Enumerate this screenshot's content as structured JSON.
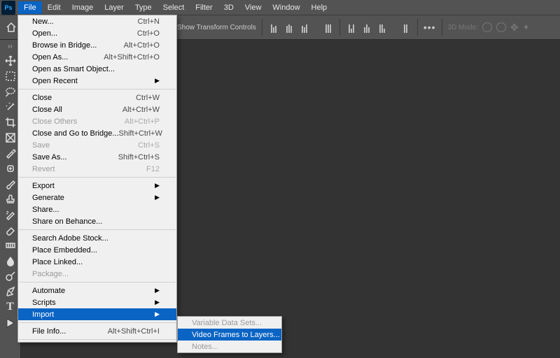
{
  "app": {
    "short": "Ps"
  },
  "menubar": [
    "File",
    "Edit",
    "Image",
    "Layer",
    "Type",
    "Select",
    "Filter",
    "3D",
    "View",
    "Window",
    "Help"
  ],
  "options": {
    "show_transform": "Show Transform Controls",
    "mode_label": "3D Mode:"
  },
  "file_menu": [
    {
      "type": "item",
      "label": "New...",
      "shortcut": "Ctrl+N"
    },
    {
      "type": "item",
      "label": "Open...",
      "shortcut": "Ctrl+O"
    },
    {
      "type": "item",
      "label": "Browse in Bridge...",
      "shortcut": "Alt+Ctrl+O"
    },
    {
      "type": "item",
      "label": "Open As...",
      "shortcut": "Alt+Shift+Ctrl+O"
    },
    {
      "type": "item",
      "label": "Open as Smart Object..."
    },
    {
      "type": "item",
      "label": "Open Recent",
      "sub": true
    },
    {
      "type": "sep"
    },
    {
      "type": "item",
      "label": "Close",
      "shortcut": "Ctrl+W"
    },
    {
      "type": "item",
      "label": "Close All",
      "shortcut": "Alt+Ctrl+W"
    },
    {
      "type": "item",
      "label": "Close Others",
      "shortcut": "Alt+Ctrl+P",
      "disabled": true
    },
    {
      "type": "item",
      "label": "Close and Go to Bridge...",
      "shortcut": "Shift+Ctrl+W"
    },
    {
      "type": "item",
      "label": "Save",
      "shortcut": "Ctrl+S",
      "disabled": true
    },
    {
      "type": "item",
      "label": "Save As...",
      "shortcut": "Shift+Ctrl+S"
    },
    {
      "type": "item",
      "label": "Revert",
      "shortcut": "F12",
      "disabled": true
    },
    {
      "type": "sep"
    },
    {
      "type": "item",
      "label": "Export",
      "sub": true
    },
    {
      "type": "item",
      "label": "Generate",
      "sub": true
    },
    {
      "type": "item",
      "label": "Share..."
    },
    {
      "type": "item",
      "label": "Share on Behance..."
    },
    {
      "type": "sep"
    },
    {
      "type": "item",
      "label": "Search Adobe Stock..."
    },
    {
      "type": "item",
      "label": "Place Embedded..."
    },
    {
      "type": "item",
      "label": "Place Linked..."
    },
    {
      "type": "item",
      "label": "Package...",
      "disabled": true
    },
    {
      "type": "sep"
    },
    {
      "type": "item",
      "label": "Automate",
      "sub": true
    },
    {
      "type": "item",
      "label": "Scripts",
      "sub": true
    },
    {
      "type": "item",
      "label": "Import",
      "sub": true,
      "highlight": true
    },
    {
      "type": "sep"
    },
    {
      "type": "item",
      "label": "File Info...",
      "shortcut": "Alt+Shift+Ctrl+I"
    },
    {
      "type": "sep"
    }
  ],
  "import_submenu": [
    {
      "label": "Variable Data Sets...",
      "disabled": true
    },
    {
      "label": "Video Frames to Layers...",
      "highlight": true
    },
    {
      "label": "Notes...",
      "disabled": true
    }
  ]
}
